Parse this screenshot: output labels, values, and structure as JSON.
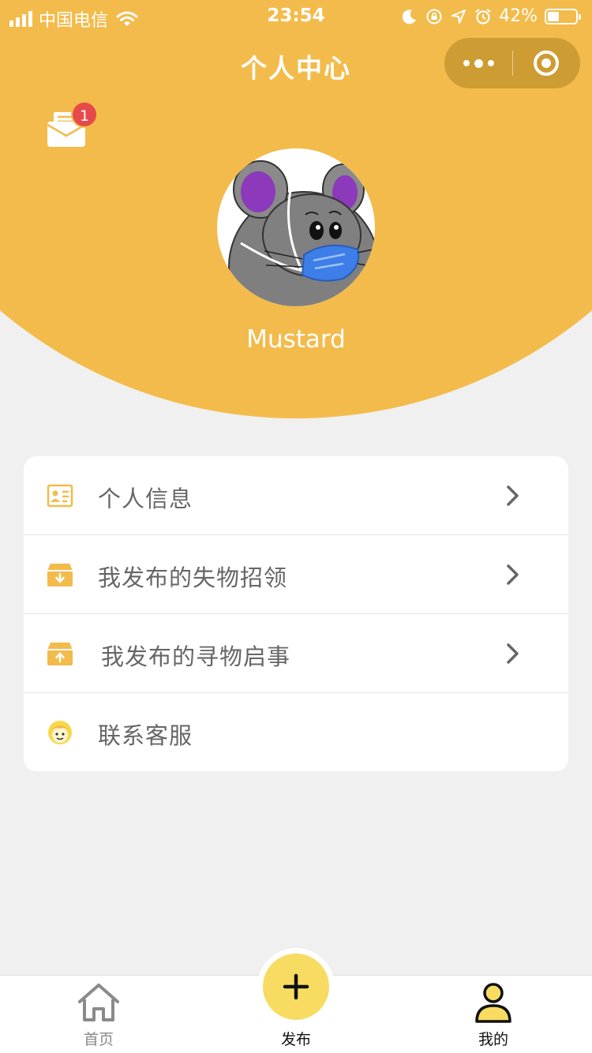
{
  "status_bar": {
    "carrier": "中国电信",
    "time": "23:54",
    "battery": "42%",
    "battery_level": 0.42
  },
  "nav": {
    "title": "个人中心"
  },
  "header": {
    "bg_color": "#f3bb4b",
    "mail_badge_count": "1",
    "username": "Mustard"
  },
  "menu": {
    "items": [
      {
        "label": "个人信息",
        "icon": "id-card-icon",
        "has_arrow": true
      },
      {
        "label": "我发布的失物招领",
        "icon": "box-download-icon",
        "has_arrow": true
      },
      {
        "label": "我发布的寻物启事",
        "icon": "box-upload-icon",
        "has_arrow": true
      },
      {
        "label": "联系客服",
        "icon": "customer-service-icon",
        "has_arrow": false
      }
    ]
  },
  "tabbar": {
    "home_label": "首页",
    "post_label": "发布",
    "mine_label": "我的",
    "active": "我的",
    "accent_color": "#f8dc62"
  }
}
